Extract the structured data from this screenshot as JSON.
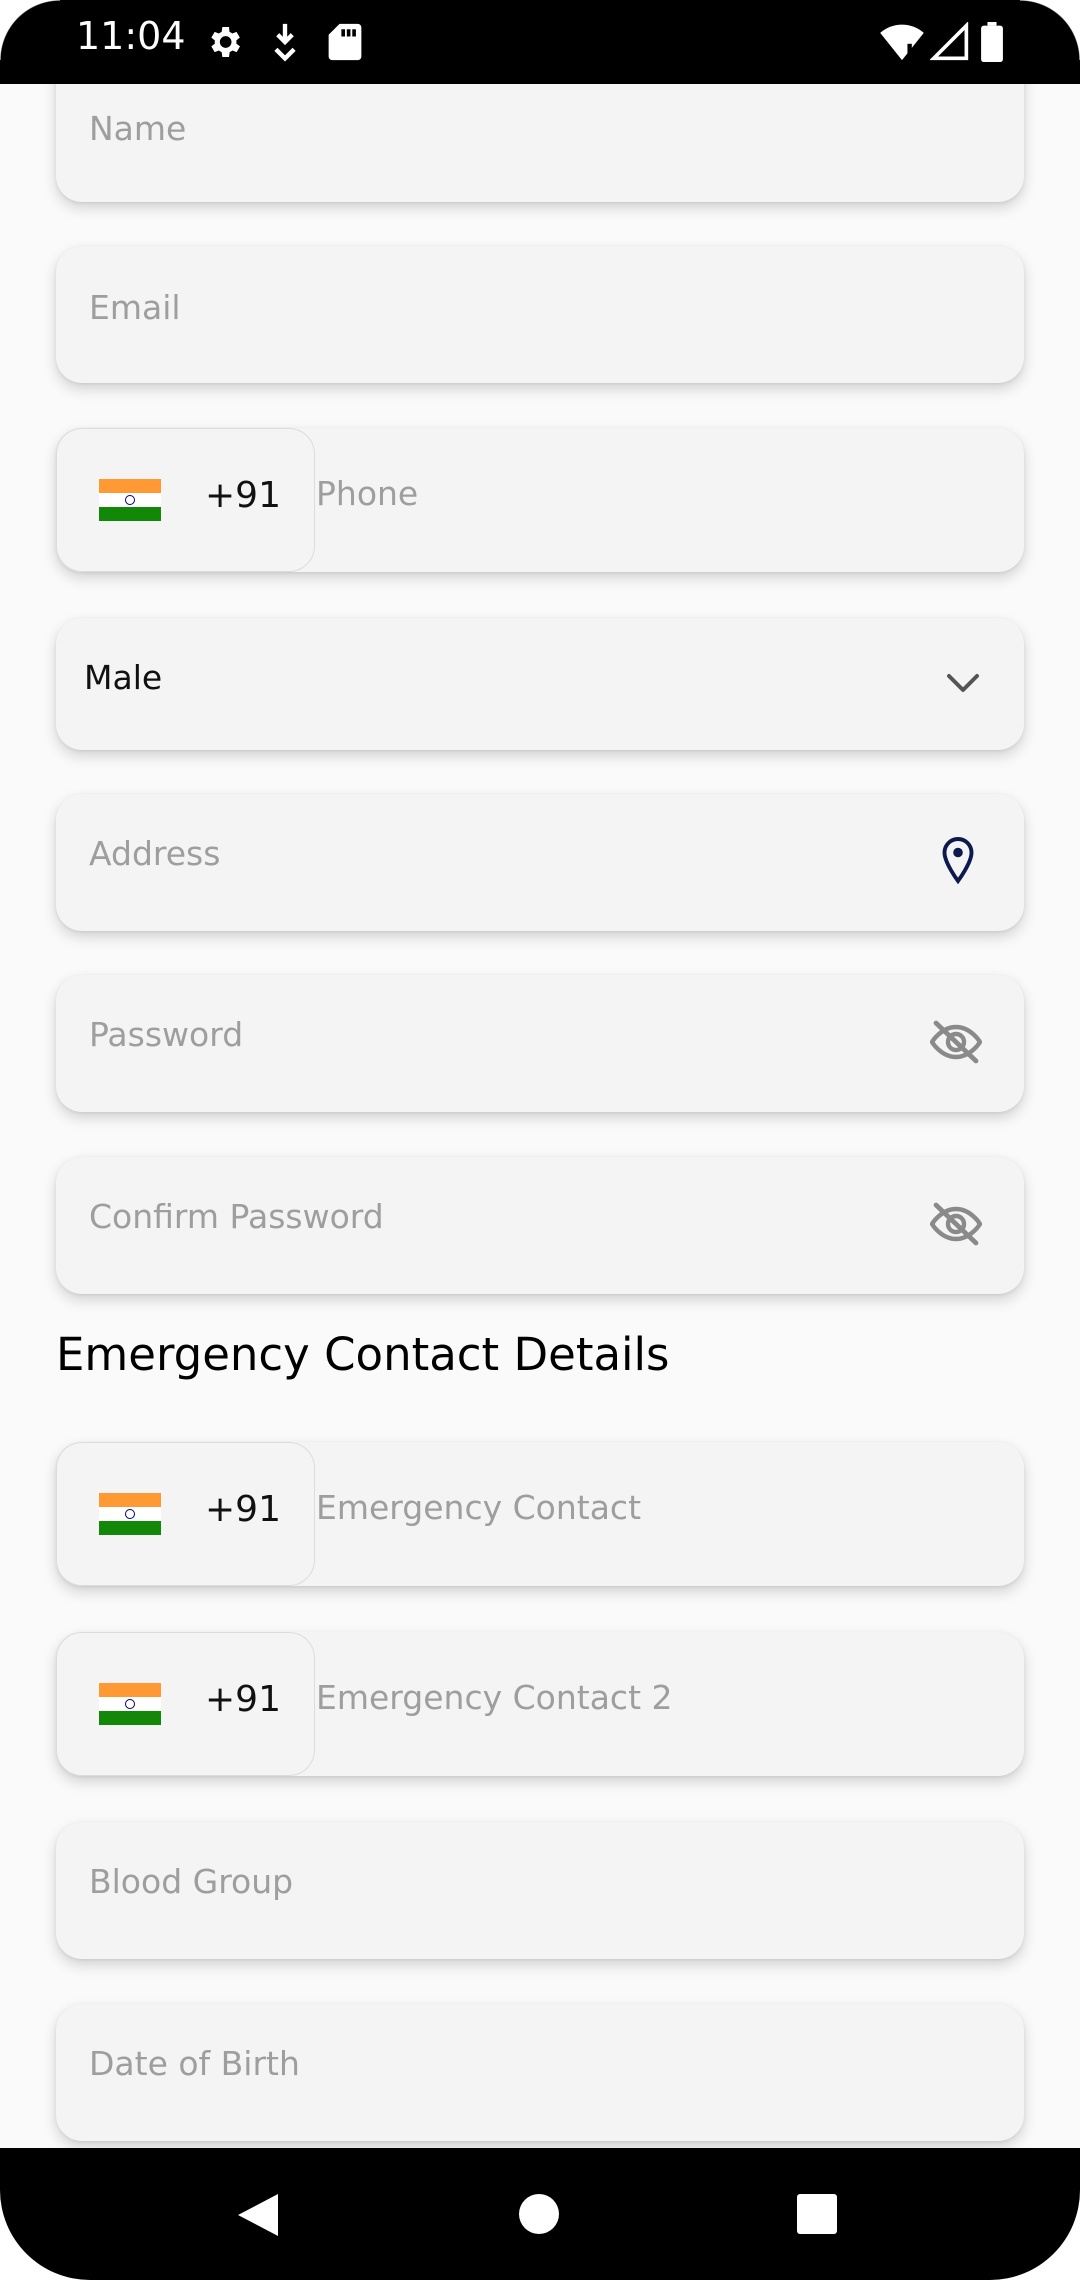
{
  "status_bar": {
    "time": "11:04",
    "icons": [
      "gear-icon",
      "download-icon",
      "sd-card-icon",
      "wifi-icon",
      "signal-icon",
      "battery-icon"
    ]
  },
  "form": {
    "name_placeholder": "Name",
    "email_placeholder": "Email",
    "phone": {
      "country_code": "+91",
      "placeholder": "Phone"
    },
    "gender": {
      "value": "Male"
    },
    "address_placeholder": "Address",
    "password_placeholder": "Password",
    "confirm_password_placeholder": "Confirm Password",
    "emergency_section_title": "Emergency Contact Details",
    "emergency_contact": {
      "country_code": "+91",
      "placeholder": "Emergency Contact"
    },
    "emergency_contact_2": {
      "country_code": "+91",
      "placeholder": "Emergency Contact 2"
    },
    "blood_group_placeholder": "Blood Group",
    "dob_placeholder": "Date of Birth"
  },
  "colors": {
    "flag_saffron": "#ff9933",
    "flag_white": "#ffffff",
    "flag_green": "#138808",
    "chakra_blue": "#000080",
    "location_pin": "#0d1a4d",
    "placeholder_gray": "#9e9e9e"
  },
  "nav_bar": {
    "icons": [
      "back-icon",
      "home-icon",
      "recents-icon"
    ]
  }
}
